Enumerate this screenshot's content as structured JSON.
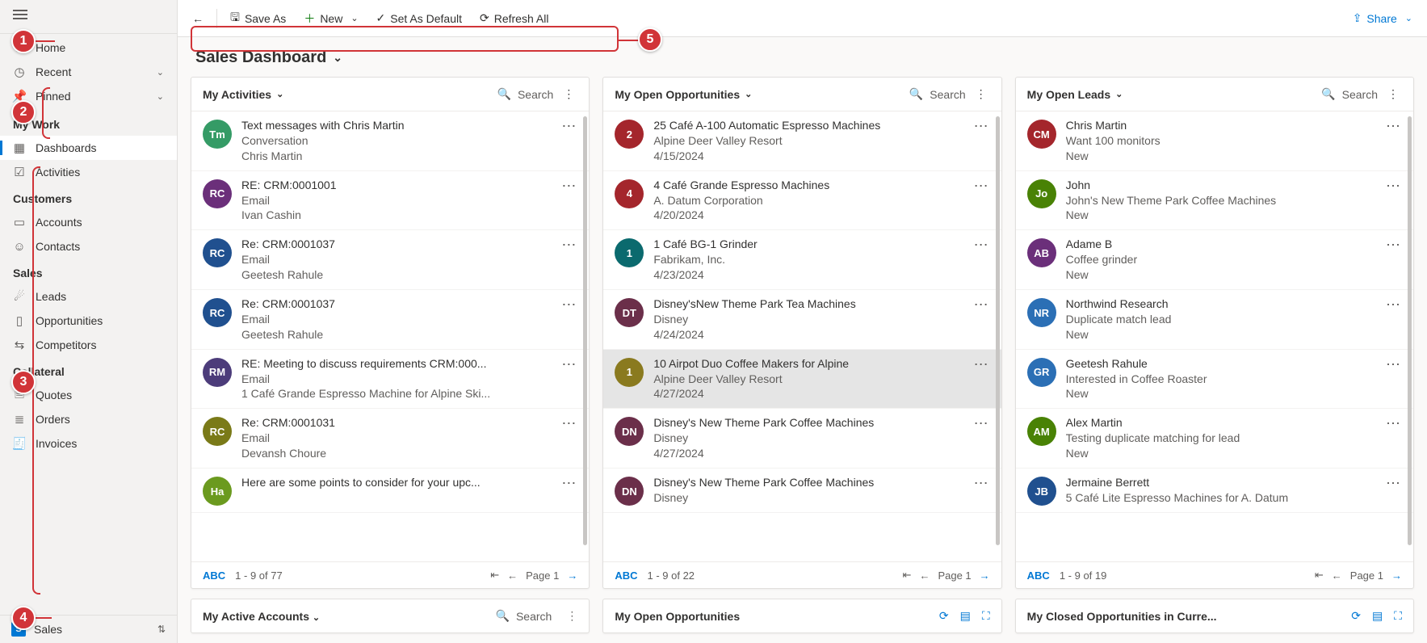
{
  "toolbar": {
    "back": "",
    "saveAs": "Save As",
    "new": "New",
    "setDefault": "Set As Default",
    "refresh": "Refresh All",
    "share": "Share"
  },
  "pageTitle": "Sales Dashboard",
  "nav": {
    "home": "Home",
    "recent": "Recent",
    "pinned": "Pinned",
    "group1": "My Work",
    "dashboards": "Dashboards",
    "activities": "Activities",
    "group2": "Customers",
    "accounts": "Accounts",
    "contacts": "Contacts",
    "group3": "Sales",
    "leads": "Leads",
    "opportunities": "Opportunities",
    "competitors": "Competitors",
    "group4": "Collateral",
    "quotes": "Quotes",
    "orders": "Orders",
    "invoices": "Invoices",
    "areaBadge": "S",
    "area": "Sales"
  },
  "panel1": {
    "title": "My Activities",
    "search": "Search",
    "abc": "ABC",
    "range": "1 - 9 of 77",
    "page": "Page 1",
    "rows": [
      {
        "av": "Tm",
        "col": "#359b66",
        "l1": "Text messages with Chris Martin",
        "l2": "Conversation",
        "l3": "Chris Martin"
      },
      {
        "av": "RC",
        "col": "#6b2f7a",
        "l1": "RE: CRM:0001001",
        "l2": "Email",
        "l3": "Ivan Cashin"
      },
      {
        "av": "RC",
        "col": "#20508f",
        "l1": "Re: CRM:0001037",
        "l2": "Email",
        "l3": "Geetesh Rahule"
      },
      {
        "av": "RC",
        "col": "#20508f",
        "l1": "Re: CRM:0001037",
        "l2": "Email",
        "l3": "Geetesh Rahule"
      },
      {
        "av": "RM",
        "col": "#4c3c7a",
        "l1": "RE: Meeting to discuss requirements CRM:000...",
        "l2": "Email",
        "l3": "1 Café Grande Espresso Machine for Alpine Ski..."
      },
      {
        "av": "RC",
        "col": "#7a7a18",
        "l1": "Re: CRM:0001031",
        "l2": "Email",
        "l3": "Devansh Choure"
      },
      {
        "av": "Ha",
        "col": "#6b9a1f",
        "l1": "Here are some points to consider for your upc...",
        "l2": "",
        "l3": ""
      }
    ]
  },
  "panel2": {
    "title": "My Open Opportunities",
    "search": "Search",
    "abc": "ABC",
    "range": "1 - 9 of 22",
    "page": "Page 1",
    "rows": [
      {
        "av": "2",
        "col": "#a4262c",
        "l1": "25 Café A-100 Automatic Espresso Machines",
        "l2": "Alpine Deer Valley Resort",
        "l3": "4/15/2024"
      },
      {
        "av": "4",
        "col": "#a4262c",
        "l1": "4 Café Grande Espresso Machines",
        "l2": "A. Datum Corporation",
        "l3": "4/20/2024"
      },
      {
        "av": "1",
        "col": "#0b6a6e",
        "l1": "1 Café BG-1 Grinder",
        "l2": "Fabrikam, Inc.",
        "l3": "4/23/2024"
      },
      {
        "av": "DT",
        "col": "#6b2f4a",
        "l1": "Disney'sNew Theme Park Tea Machines",
        "l2": "Disney",
        "l3": "4/24/2024"
      },
      {
        "av": "1",
        "col": "#8a7a1f",
        "l1": "10 Airpot Duo Coffee Makers for Alpine",
        "l2": "Alpine Deer Valley Resort",
        "l3": "4/27/2024",
        "sel": true
      },
      {
        "av": "DN",
        "col": "#6b2f4a",
        "l1": "Disney's New Theme Park Coffee Machines",
        "l2": "Disney",
        "l3": "4/27/2024"
      },
      {
        "av": "DN",
        "col": "#6b2f4a",
        "l1": "Disney's New Theme Park Coffee Machines",
        "l2": "Disney",
        "l3": ""
      }
    ]
  },
  "panel3": {
    "title": "My Open Leads",
    "search": "Search",
    "abc": "ABC",
    "range": "1 - 9 of 19",
    "page": "Page 1",
    "rows": [
      {
        "av": "CM",
        "col": "#a4262c",
        "l1": "Chris Martin",
        "l2": "Want 100 monitors",
        "l3": "New"
      },
      {
        "av": "Jo",
        "col": "#498205",
        "l1": "John",
        "l2": "John's New Theme Park Coffee Machines",
        "l3": "New"
      },
      {
        "av": "AB",
        "col": "#6b2f7a",
        "l1": "Adame B",
        "l2": "Coffee grinder",
        "l3": "New"
      },
      {
        "av": "NR",
        "col": "#2b6fb5",
        "l1": "Northwind Research",
        "l2": "Duplicate match lead",
        "l3": "New"
      },
      {
        "av": "GR",
        "col": "#2b6fb5",
        "l1": "Geetesh Rahule",
        "l2": "Interested in Coffee Roaster",
        "l3": "New"
      },
      {
        "av": "AM",
        "col": "#498205",
        "l1": "Alex Martin",
        "l2": "Testing duplicate matching for lead",
        "l3": "New"
      },
      {
        "av": "JB",
        "col": "#20508f",
        "l1": "Jermaine Berrett",
        "l2": "5 Café Lite Espresso Machines for A. Datum",
        "l3": ""
      }
    ]
  },
  "bottom": {
    "p1": {
      "title": "My Active Accounts",
      "search": "Search"
    },
    "p2": {
      "title": "My Open Opportunities"
    },
    "p3": {
      "title": "My Closed Opportunities in Curre..."
    }
  }
}
